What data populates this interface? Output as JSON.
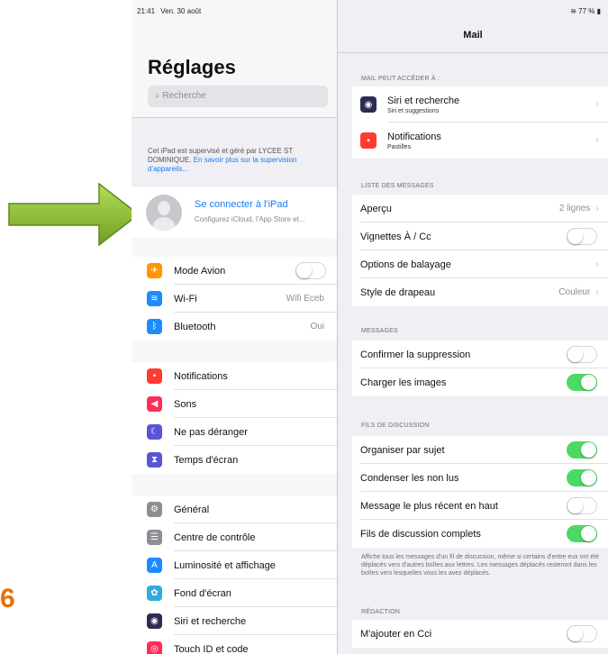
{
  "status": {
    "time": "21:41",
    "date": "Ven. 30 août",
    "battery": "77 %"
  },
  "left": {
    "title": "Réglages",
    "search_placeholder": "Recherche",
    "supervision_text": "Cet iPad est supervisé et géré par LYCEE ST DOMINIQUE.",
    "supervision_link": "En savoir plus sur la supervision d'appareils...",
    "account_title": "Se connecter à l'iPad",
    "account_sub": "Configurez iCloud, l'App Store et...",
    "group1": [
      {
        "label": "Mode Avion",
        "icon": "airplane-icon",
        "color": "#ff9500",
        "glyph": "✈",
        "toggle": "off",
        "value": ""
      },
      {
        "label": "Wi-Fi",
        "icon": "wifi-icon",
        "color": "#1a8cff",
        "glyph": "≋",
        "toggle": "",
        "value": "Wifi Eceb"
      },
      {
        "label": "Bluetooth",
        "icon": "bluetooth-icon",
        "color": "#1a8cff",
        "glyph": "ᛒ",
        "toggle": "",
        "value": "Oui"
      }
    ],
    "group2": [
      {
        "label": "Notifications",
        "icon": "notifications-icon",
        "color": "#ff3b30",
        "glyph": "▪",
        "value": ""
      },
      {
        "label": "Sons",
        "icon": "sounds-icon",
        "color": "#ff2d55",
        "glyph": "◀",
        "value": ""
      },
      {
        "label": "Ne pas déranger",
        "icon": "moon-icon",
        "color": "#5856d6",
        "glyph": "☾",
        "value": ""
      },
      {
        "label": "Temps d'écran",
        "icon": "hourglass-icon",
        "color": "#5856d6",
        "glyph": "⧗",
        "value": ""
      }
    ],
    "group3": [
      {
        "label": "Général",
        "icon": "gear-icon",
        "color": "#8e8e93",
        "glyph": "⚙",
        "value": ""
      },
      {
        "label": "Centre de contrôle",
        "icon": "control-center-icon",
        "color": "#8e8e93",
        "glyph": "☰",
        "value": ""
      },
      {
        "label": "Luminosité et affichage",
        "icon": "brightness-icon",
        "color": "#1a8cff",
        "glyph": "A",
        "value": ""
      },
      {
        "label": "Fond d'écran",
        "icon": "wallpaper-icon",
        "color": "#34aadc",
        "glyph": "✿",
        "value": ""
      },
      {
        "label": "Siri et recherche",
        "icon": "siri-icon",
        "color": "#2c2c54",
        "glyph": "◉",
        "value": ""
      },
      {
        "label": "Touch ID et code",
        "icon": "fingerprint-icon",
        "color": "#ff2d55",
        "glyph": "◎",
        "value": ""
      }
    ]
  },
  "right": {
    "nav_title": "Mail",
    "sec1": "MAIL PEUT ACCÉDER À :",
    "access": [
      {
        "l1": "Siri et recherche",
        "l2": "Siri et suggestions",
        "icon": "siri-icon",
        "color": "#2c2c54",
        "glyph": "◉"
      },
      {
        "l1": "Notifications",
        "l2": "Pastilles",
        "icon": "notifications-icon",
        "color": "#ff3b30",
        "glyph": "▪"
      }
    ],
    "sec2": "LISTE DES MESSAGES",
    "list": [
      {
        "label": "Aperçu",
        "value": "2 lignes",
        "chev": true,
        "toggle": ""
      },
      {
        "label": "Vignettes À / Cc",
        "value": "",
        "chev": false,
        "toggle": "off"
      },
      {
        "label": "Options de balayage",
        "value": "",
        "chev": true,
        "toggle": ""
      },
      {
        "label": "Style de drapeau",
        "value": "Couleur",
        "chev": true,
        "toggle": ""
      }
    ],
    "sec3": "MESSAGES",
    "messages": [
      {
        "label": "Confirmer la suppression",
        "toggle": "off"
      },
      {
        "label": "Charger les images",
        "toggle": "on"
      }
    ],
    "sec4": "FILS DE DISCUSSION",
    "threads": [
      {
        "label": "Organiser par sujet",
        "toggle": "on"
      },
      {
        "label": "Condenser les non lus",
        "toggle": "on"
      },
      {
        "label": "Message le plus récent en haut",
        "toggle": "off"
      },
      {
        "label": "Fils de discussion complets",
        "toggle": "on"
      }
    ],
    "footer": "Affiche tous les messages d'un fil de discussion, même si certains d'entre eux ont été déplacés vers d'autres boîtes aux lettres. Les messages déplacés resteront dans les boîtes vers lesquelles vous les avez déplacés.",
    "sec5": "RÉDACTION",
    "compose": [
      {
        "label": "M'ajouter en Cci",
        "toggle": "off"
      }
    ]
  },
  "overlay": {
    "number": "6",
    "arrow_color": "#8cc43f"
  }
}
